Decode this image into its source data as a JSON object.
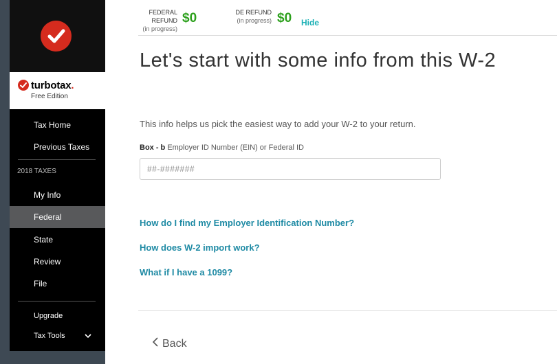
{
  "refunds": {
    "federal": {
      "label": "FEDERAL REFUND",
      "status": "(in progress)",
      "amount": "$0"
    },
    "state": {
      "label": "DE REFUND",
      "status": "(in progress)",
      "amount": "$0"
    },
    "hide_label": "Hide"
  },
  "brand": {
    "name": "turbotax",
    "dot": ".",
    "edition": "Free Edition"
  },
  "sidebar": {
    "tax_home": "Tax Home",
    "previous_taxes": "Previous Taxes",
    "section": "2018 TAXES",
    "my_info": "My Info",
    "federal": "Federal",
    "state": "State",
    "review": "Review",
    "file": "File",
    "upgrade": "Upgrade",
    "tax_tools": "Tax Tools"
  },
  "main": {
    "title": "Let's start with some info from this W-2",
    "intro": "This info helps us pick the easiest way to add your W-2 to your return.",
    "field_box": "Box - b",
    "field_label": " Employer ID Number (EIN) or Federal ID",
    "ein_placeholder": "##-#######",
    "links": [
      "How do I find my Employer Identification Number?",
      "How does W-2 import work?",
      "What if I have a 1099?"
    ],
    "back_label": "Back"
  },
  "colors": {
    "brand_red": "#d52b1e",
    "refund_green": "#2ca01c",
    "link_teal": "#1e8aa4",
    "active_nav": "#58595b"
  },
  "icons": {
    "logo": "checkmark-icon",
    "back": "chevron-left-icon",
    "tools": "chevron-down-icon"
  }
}
